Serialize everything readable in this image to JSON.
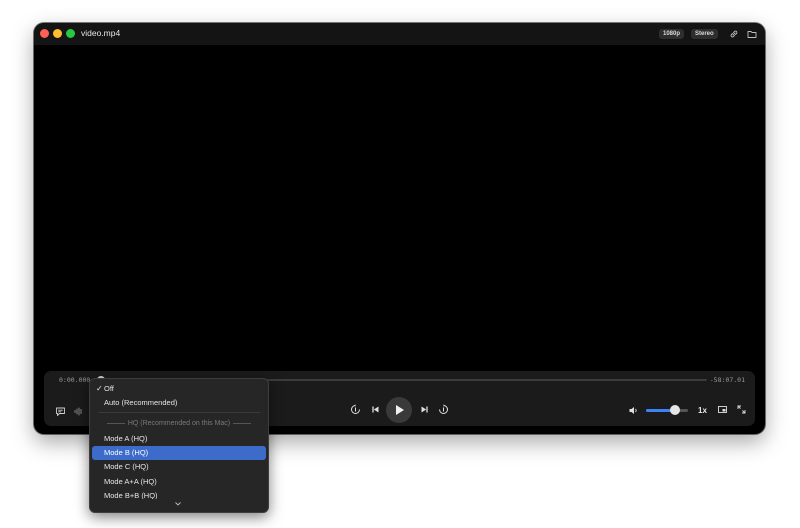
{
  "window": {
    "title": "video.mp4",
    "badges": {
      "resolution": "1080p",
      "audio": "Stereo"
    }
  },
  "playback": {
    "current_time": "0:00.000",
    "remaining_time": "-58:07.01",
    "progress": 0.0,
    "volume": 0.7,
    "speed": "1x"
  },
  "menu": {
    "items_top": [
      {
        "label": "Off",
        "checked": true
      },
      {
        "label": "Auto (Recommended)",
        "checked": false
      }
    ],
    "section_header": "HQ (Recommended on this Mac)",
    "modes": [
      {
        "label": "Mode A (HQ)",
        "selected": false
      },
      {
        "label": "Mode B (HQ)",
        "selected": true
      },
      {
        "label": "Mode C (HQ)",
        "selected": false
      },
      {
        "label": "Mode A+A (HQ)",
        "selected": false
      },
      {
        "label": "Mode B+B (HQ)",
        "selected": false
      }
    ]
  },
  "icons": {
    "titlebar": [
      "link-icon",
      "folder-icon"
    ],
    "controls": [
      "subtitles-icon",
      "audio-waveform-icon",
      "skip-back-15-icon",
      "previous-icon",
      "play-icon",
      "next-icon",
      "skip-forward-15-icon",
      "volume-icon",
      "picture-in-picture-icon",
      "fullscreen-icon"
    ]
  },
  "colors": {
    "accent": "#3b82f6",
    "menu_selection": "#3d6bc9"
  }
}
